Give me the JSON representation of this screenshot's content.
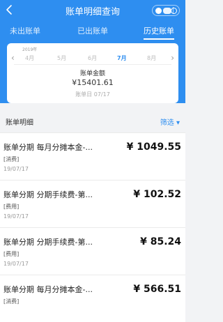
{
  "header": {
    "title": "账单明细查询",
    "back_icon": "back-icon"
  },
  "tabs": [
    {
      "label": "未出账单"
    },
    {
      "label": "已出账单"
    },
    {
      "label": "历史账单"
    }
  ],
  "card": {
    "year": "2019年",
    "months": [
      "4月",
      "5月",
      "6月",
      "7月",
      "8月"
    ],
    "active_month": "7月",
    "amount_label": "账单金额",
    "amount": "¥15401.61",
    "date": "账单日 07/17"
  },
  "detail": {
    "title": "账单明细",
    "filter": "筛选 ▾"
  },
  "items": [
    {
      "title": "账单分期 每月分摊本金-...",
      "price": "¥ 1049.55",
      "tag": "[消费]",
      "time": "19/07/17"
    },
    {
      "title": "账单分期 分期手续费-第...",
      "price": "¥ 102.52",
      "tag": "[费用]",
      "time": "19/07/17"
    },
    {
      "title": "账单分期 分期手续费-第...",
      "price": "¥ 85.24",
      "tag": "[费用]",
      "time": "19/07/17"
    },
    {
      "title": "账单分期 每月分摊本金-...",
      "price": "¥ 566.51",
      "tag": "[消费]",
      "time": ""
    }
  ]
}
